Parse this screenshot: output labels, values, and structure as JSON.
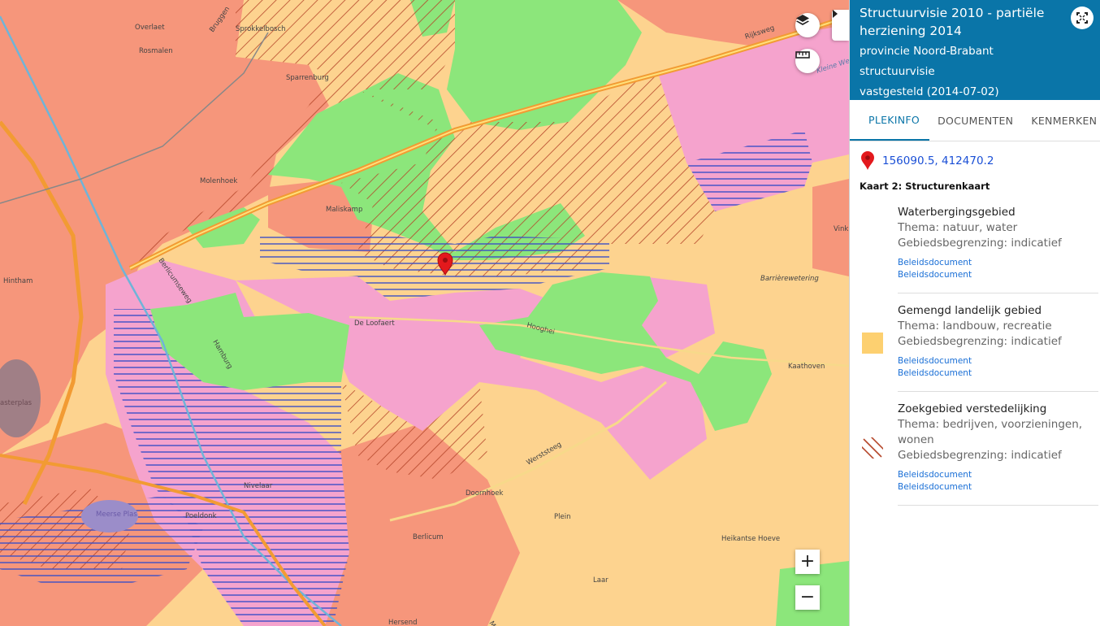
{
  "panel": {
    "title": "Structuurvisie 2010 - partiële herziening 2014",
    "subtitle1": "provincie Noord-Brabant",
    "subtitle2": "structuurvisie",
    "subtitle3": "vastgesteld (2014-07-02)",
    "tabs": [
      "PLEKINFO",
      "DOCUMENTEN",
      "KENMERKEN"
    ],
    "coordinates": "156090.5, 412470.2",
    "map_heading": "Kaart 2: Structurenkaart",
    "items": [
      {
        "name": "Waterbergingsgebied",
        "thema": "Thema: natuur, water",
        "begrenzing": "Gebiedsbegrenzing: indicatief",
        "links": [
          "Beleidsdocument",
          "Beleidsdocument"
        ],
        "legend_color": "#ffffff"
      },
      {
        "name": "Gemengd landelijk gebied",
        "thema": "Thema: landbouw, recreatie",
        "begrenzing": "Gebiedsbegrenzing: indicatief",
        "links": [
          "Beleidsdocument",
          "Beleidsdocument"
        ],
        "legend_color": "#fdd070"
      },
      {
        "name": "Zoekgebied verstedelijking",
        "thema": "Thema: bedrijven, voorzieningen, wonen",
        "begrenzing": "Gebiedsbegrenzing: indicatief",
        "links": [
          "Beleidsdocument",
          "Beleidsdocument"
        ],
        "legend_color": "#b5462a"
      }
    ]
  },
  "map": {
    "labels": {
      "overlaet": "Overlaet",
      "rosmalen": "Rosmalen",
      "bruggen": "Bruggen",
      "sprokkelbosch": "Sprokkelbosch",
      "sparrenburg": "Sparrenburg",
      "molenhoek": "Molenhoek",
      "maliskamp": "Maliskamp",
      "hintham": "Hintham",
      "berlicumseweg": "Berlicumseweg",
      "deloofaert": "De Loofaert",
      "hooghei": "Hooghei",
      "hamburg": "Hamburg",
      "werststeeg": "Werststeeg",
      "doornhoek": "Doornhoek",
      "plein": "Plein",
      "berlicum": "Berlicum",
      "nivelaar": "Nivelaar",
      "poeldonk": "Poeldonk",
      "meerse_plas": "Meerse Plas",
      "asterplas": "asterplas",
      "heikantse_hoeve": "Heikantse Hoeve",
      "laar": "Laar",
      "kaathoven": "Kaathoven",
      "barrierewetering": "Barrièrewetering",
      "rijksweg": "Rijksweg",
      "vink": "Vink",
      "kleine_wetering": "Kleine Wetering",
      "hersend": "Hersend",
      "mr": "Mi"
    },
    "colors": {
      "urban": "#f6967b",
      "rural_mixed": "#fdd38f",
      "nature": "#8ce67b",
      "pink_zone": "#f5a3cd",
      "hatch_blue": "#3b4fc5",
      "hatch_red": "#b5462a"
    },
    "icons": {
      "layers": "layers-icon",
      "measure": "ruler-icon",
      "marker": "map-marker-icon",
      "fullscreen": "fullscreen-icon",
      "collapse": "chevron-right-icon"
    },
    "zoom_in_label": "+",
    "zoom_out_label": "−"
  }
}
